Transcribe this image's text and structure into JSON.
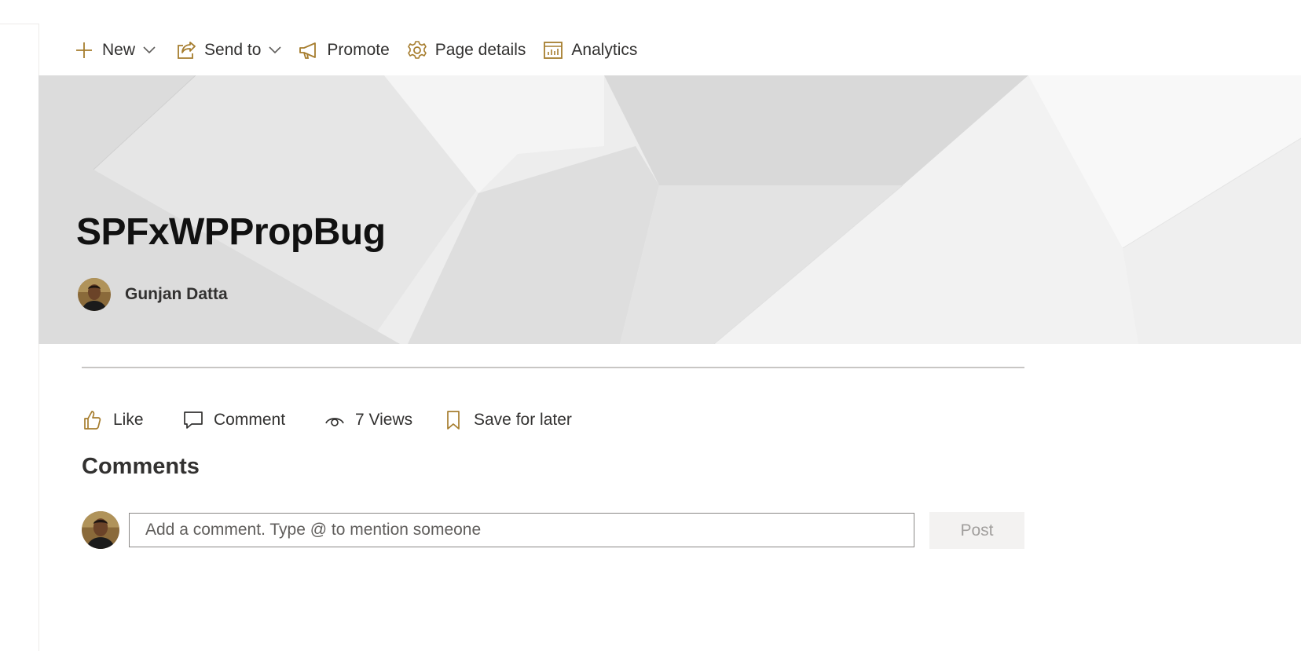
{
  "command_bar": {
    "new_label": "New",
    "send_to_label": "Send to",
    "promote_label": "Promote",
    "page_details_label": "Page details",
    "analytics_label": "Analytics"
  },
  "hero": {
    "title": "SPFxWPPropBug",
    "author_name": "Gunjan Datta"
  },
  "social": {
    "like_label": "Like",
    "comment_label": "Comment",
    "views_label": "7 Views",
    "save_label": "Save for later"
  },
  "comments": {
    "heading": "Comments",
    "input_placeholder": "Add a comment. Type @ to mention someone",
    "post_label": "Post"
  },
  "colors": {
    "icon_accent": "#a67d2e",
    "title": "#111111",
    "text": "#323130"
  }
}
